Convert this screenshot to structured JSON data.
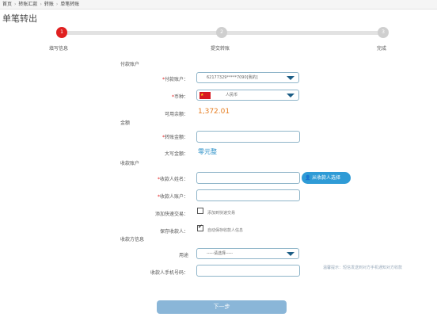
{
  "breadcrumb": [
    "首页",
    "转账汇款",
    "转账",
    "单笔转账"
  ],
  "page_title": "单笔转出",
  "steps": [
    {
      "num": "1",
      "label": "填写信息"
    },
    {
      "num": "2",
      "label": "提交转账"
    },
    {
      "num": "3",
      "label": "完成"
    }
  ],
  "sections": {
    "payer": "付款账户",
    "amount": "金额",
    "payee": "收款账户",
    "payee_info": "收款方信息"
  },
  "payer": {
    "account_label": "付款账户：",
    "account_value": "62177329*****7090[我的]",
    "currency_label": "币种：",
    "currency_value": "人民币",
    "balance_label": "可用余额：",
    "balance_value": "1,372.01"
  },
  "amount": {
    "transfer_label": "转账金额：",
    "upper_label": "大写金额：",
    "upper_value": "零元整"
  },
  "payee": {
    "name_label": "收款人姓名：",
    "pick_button": "从收款人选择",
    "account_label": "收款人账户：",
    "add_quick_label": "添加快速交易：",
    "add_quick_text": "添加到快速交易",
    "save_label": "保存收款人：",
    "save_text": "自动保存收款人信息",
    "save_checked": true
  },
  "payee_info": {
    "purpose_label": "用途",
    "purpose_value": "-----请选择-----",
    "phone_label": "收款人手机号码：",
    "hint": "温馨提示：短信发送到对方手机通知对方收款"
  },
  "next_button": "下一步",
  "colors": {
    "accent": "#2f9bd6",
    "step_active": "#e02020",
    "amount": "#e67e22"
  }
}
